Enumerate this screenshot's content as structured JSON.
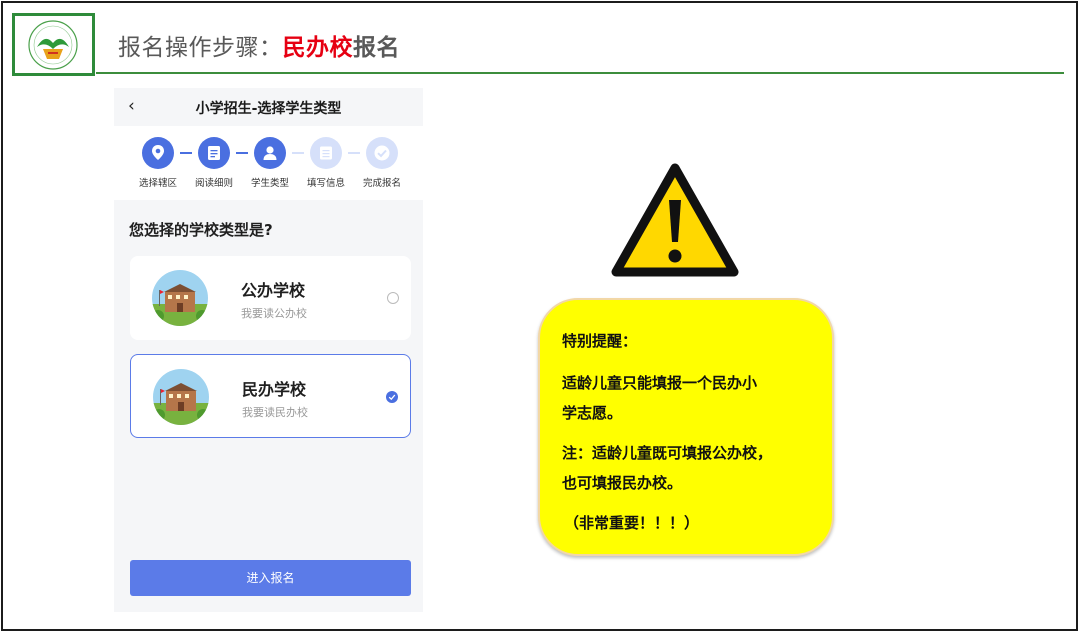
{
  "header": {
    "logo_name": "school-logo",
    "title_prefix": "报名操作步骤：",
    "title_highlight": "民办校",
    "title_suffix": "报名"
  },
  "phone": {
    "back_icon": "‹",
    "nav_title": "小学招生-选择学生类型",
    "steps": [
      {
        "label": "选择辖区",
        "icon": "location-pin-icon",
        "state": "done"
      },
      {
        "label": "阅读细则",
        "icon": "document-icon",
        "state": "done"
      },
      {
        "label": "学生类型",
        "icon": "user-icon",
        "state": "current"
      },
      {
        "label": "填写信息",
        "icon": "form-icon",
        "state": "pending"
      },
      {
        "label": "完成报名",
        "icon": "check-circle-icon",
        "state": "pending"
      }
    ],
    "question": "您选择的学校类型是?",
    "options": [
      {
        "name": "公办学校",
        "sub": "我要读公办校",
        "selected": false
      },
      {
        "name": "民办学校",
        "sub": "我要读民办校",
        "selected": true
      }
    ],
    "enter_button": "进入报名"
  },
  "warning": {
    "icon": "warning-triangle-icon",
    "line1": "特别提醒：",
    "line2": "适龄儿童只能填报一个民办小",
    "line3": "学志愿。",
    "line4": "注：适龄儿童既可填报公办校，",
    "line5": "也可填报民办校。",
    "line6": "（非常重要！！！）"
  },
  "colors": {
    "accent": "#4a6fe0",
    "highlight_red": "#e60012",
    "note_yellow": "#ffff00",
    "rule_green": "#3c8d3c"
  }
}
